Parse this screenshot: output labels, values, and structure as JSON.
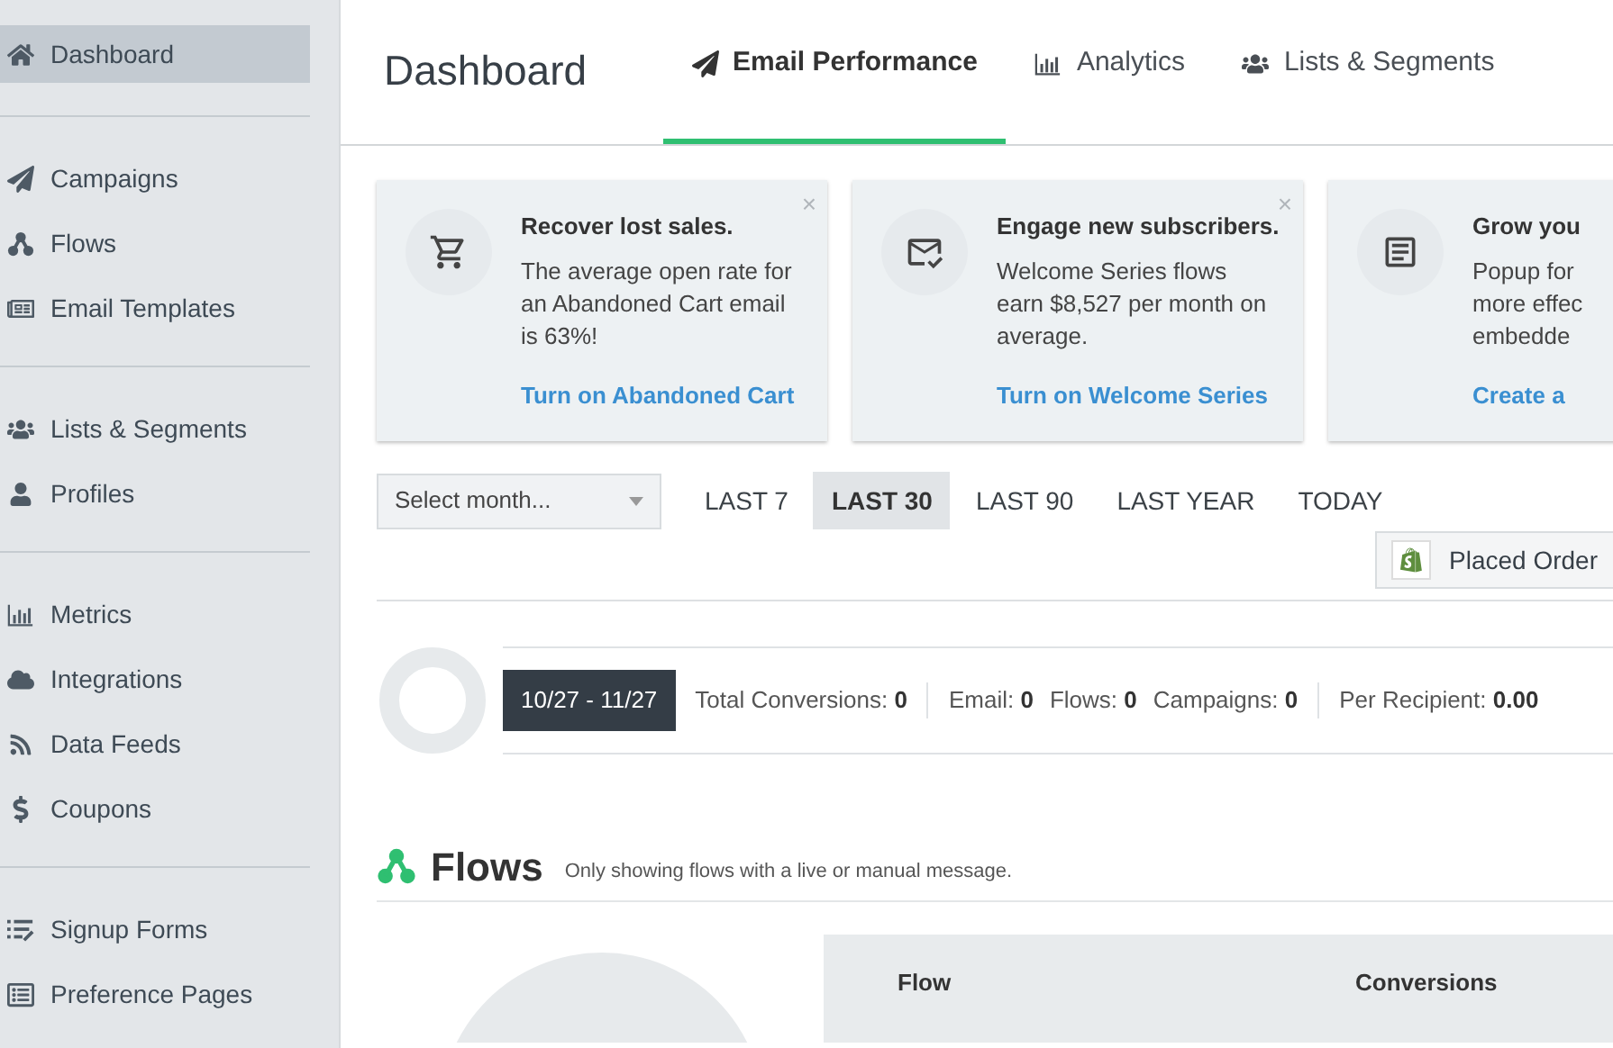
{
  "sidebar": {
    "groups": [
      [
        {
          "label": "Dashboard",
          "kind": "home",
          "selected": true
        }
      ],
      [
        {
          "label": "Campaigns",
          "kind": "plane",
          "selected": false
        },
        {
          "label": "Flows",
          "kind": "flow",
          "selected": false
        },
        {
          "label": "Email Templates",
          "kind": "template",
          "selected": false
        }
      ],
      [
        {
          "label": "Lists & Segments",
          "kind": "users",
          "selected": false
        },
        {
          "label": "Profiles",
          "kind": "user",
          "selected": false
        }
      ],
      [
        {
          "label": "Metrics",
          "kind": "chart",
          "selected": false
        },
        {
          "label": "Integrations",
          "kind": "cloud",
          "selected": false
        },
        {
          "label": "Data Feeds",
          "kind": "rss",
          "selected": false
        },
        {
          "label": "Coupons",
          "kind": "dollar",
          "selected": false
        }
      ],
      [
        {
          "label": "Signup Forms",
          "kind": "listedit",
          "selected": false
        },
        {
          "label": "Preference Pages",
          "kind": "page",
          "selected": false
        }
      ]
    ]
  },
  "header": {
    "title": "Dashboard",
    "tabs": [
      {
        "label": "Email Performance",
        "kind": "plane",
        "selected": true
      },
      {
        "label": "Analytics",
        "kind": "chart",
        "selected": false
      },
      {
        "label": "Lists & Segments",
        "kind": "users",
        "selected": false
      }
    ]
  },
  "cards": [
    {
      "kind": "cart",
      "title": "Recover lost sales.",
      "lines": [
        "The average open rate for",
        "an Abandoned Cart email",
        "is 63%!"
      ],
      "link": "Turn on Abandoned Cart",
      "close": "×"
    },
    {
      "kind": "envelope",
      "title": "Engage new subscribers.",
      "lines": [
        "Welcome Series flows",
        "earn $8,527 per month on",
        "average."
      ],
      "link": "Turn on Welcome Series",
      "close": "×"
    },
    {
      "kind": "form",
      "title": "Grow you",
      "lines": [
        "Popup for",
        "more effec",
        "embedde"
      ],
      "link": "Create a"
    }
  ],
  "filters": {
    "month": {
      "placeholder": "Select month..."
    },
    "ranges": [
      {
        "label": "LAST 7",
        "selected": false
      },
      {
        "label": "LAST 30",
        "selected": true
      },
      {
        "label": "LAST 90",
        "selected": false
      },
      {
        "label": "LAST YEAR",
        "selected": false
      },
      {
        "label": "TODAY",
        "selected": false
      }
    ],
    "metric": "Placed Order"
  },
  "summary": {
    "range": "10/27 - 11/27",
    "groups": [
      [
        {
          "label": "Total Conversions:",
          "value": "0"
        }
      ],
      [
        {
          "label": "Email:",
          "value": "0"
        },
        {
          "label": "Flows:",
          "value": "0"
        },
        {
          "label": "Campaigns:",
          "value": "0"
        }
      ],
      [
        {
          "label": "Per Recipient:",
          "value": "0.00"
        }
      ]
    ]
  },
  "flows": {
    "title": "Flows",
    "note": "Only showing flows with a live or manual message.",
    "columns": [
      "Flow",
      "Conversions"
    ]
  }
}
